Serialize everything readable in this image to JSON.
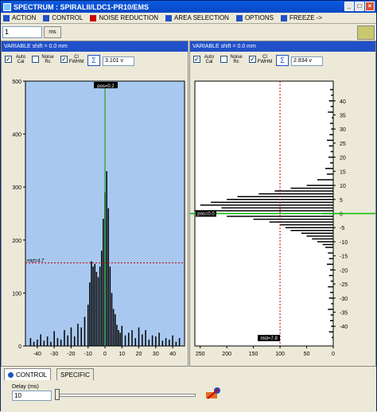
{
  "window": {
    "title": "SPECTRUM : SPIRALII/LDC1-PR10/EMS"
  },
  "menu": [
    {
      "label": "ACTION",
      "icon": "action-icon",
      "color": "#2050c8"
    },
    {
      "label": "CONTROL",
      "icon": "control-icon",
      "color": "#2050c8"
    },
    {
      "label": "NOISE REDUCTION",
      "icon": "noise-reduction-icon",
      "color": "#c80000"
    },
    {
      "label": "AREA SELECTION",
      "icon": "area-selection-icon",
      "color": "#2050c8"
    },
    {
      "label": "OPTIONS",
      "icon": "options-icon",
      "color": "#2050c8"
    },
    {
      "label": "FREEZE ->",
      "icon": "freeze-icon",
      "color": "#2050c8"
    }
  ],
  "toolbar": {
    "value": "1",
    "unit": "ms"
  },
  "left_panel": {
    "header": "VARIABLE shift = 0.0 mm",
    "auto_cal": {
      "label": "Auto Cal",
      "checked": true
    },
    "noise_rc": {
      "label": "Noise Rc",
      "checked": false
    },
    "cl_fwhm": {
      "label": "Cl FWHM",
      "checked": true
    },
    "sigma_value": "3.101 v",
    "marker_top": "pos=0.2",
    "marker_mid": "mid=4.7"
  },
  "right_panel": {
    "header": "VARIABLE shift = 0.0 mm",
    "auto_cal": {
      "label": "Auto Cal",
      "checked": true
    },
    "noise_rc": {
      "label": "Noise Rc",
      "checked": false
    },
    "cl_fwhm": {
      "label": "Cl FWHM",
      "checked": true
    },
    "sigma_value": "2.834 v",
    "marker_left": "pos=0.0",
    "marker_bottom": "mid=7.8"
  },
  "tabs": {
    "control": "CONTROL",
    "specific": "SPECIFIC"
  },
  "delay": {
    "label": "Delay (ms)",
    "value": "10"
  },
  "chart_data": [
    {
      "type": "bar",
      "x": [
        -44,
        -42,
        -40,
        -38,
        -36,
        -34,
        -32,
        -30,
        -28,
        -26,
        -24,
        -22,
        -20,
        -18,
        -16,
        -14,
        -12,
        -10,
        -9,
        -8,
        -7,
        -6,
        -5,
        -4,
        -3,
        -2,
        -1,
        0,
        1,
        2,
        3,
        4,
        5,
        6,
        7,
        8,
        9,
        10,
        12,
        14,
        16,
        18,
        20,
        22,
        24,
        26,
        28,
        30,
        32,
        34,
        36,
        38,
        40,
        42,
        44
      ],
      "values": [
        15,
        8,
        12,
        22,
        10,
        18,
        8,
        28,
        15,
        12,
        30,
        20,
        35,
        18,
        42,
        35,
        55,
        78,
        120,
        160,
        150,
        155,
        140,
        130,
        150,
        180,
        240,
        290,
        330,
        260,
        150,
        100,
        70,
        60,
        40,
        30,
        25,
        38,
        20,
        25,
        30,
        15,
        35,
        22,
        30,
        12,
        20,
        18,
        25,
        10,
        15,
        12,
        20,
        8,
        15
      ],
      "xlim": [
        -47,
        47
      ],
      "ylim": [
        0,
        500
      ],
      "xticks": [
        -40,
        -30,
        -20,
        -10,
        0,
        10,
        20,
        30,
        40
      ],
      "yticks": [
        0,
        100,
        200,
        300,
        400,
        500
      ],
      "series_color": "#000000",
      "background": "#a8c8f0"
    },
    {
      "type": "bar",
      "orientation": "horizontal",
      "y": [
        44,
        42,
        40,
        38,
        36,
        34,
        32,
        30,
        28,
        26,
        24,
        22,
        20,
        18,
        16,
        14,
        12,
        10,
        9,
        8,
        7,
        6,
        5,
        4,
        3,
        2,
        1,
        0,
        -1,
        -2,
        -3,
        -4,
        -5,
        -6,
        -7,
        -8,
        -9,
        -10,
        -11,
        -12,
        -14,
        -16,
        -18,
        -20,
        -22,
        -24,
        -26,
        -28,
        -30,
        -32,
        -34,
        -36,
        -38,
        -40,
        -42,
        -44
      ],
      "values": [
        6,
        4,
        8,
        5,
        10,
        3,
        6,
        4,
        7,
        12,
        8,
        5,
        9,
        6,
        15,
        12,
        30,
        50,
        80,
        110,
        140,
        180,
        200,
        230,
        250,
        210,
        260,
        20,
        200,
        150,
        120,
        100,
        90,
        80,
        60,
        50,
        40,
        30,
        20,
        15,
        10,
        8,
        12,
        6,
        8,
        5,
        10,
        6,
        8,
        4,
        10,
        5,
        6,
        4,
        8,
        3
      ],
      "ylim": [
        -47,
        47
      ],
      "xlim": [
        0,
        260
      ],
      "xticks": [
        250,
        200,
        150,
        100,
        50,
        0
      ],
      "yticks": [
        40,
        35,
        30,
        25,
        20,
        15,
        10,
        5,
        0,
        -5,
        -10,
        -15,
        -20,
        -25,
        -30,
        -35,
        -40
      ],
      "series_color": "#000000",
      "background": "#ffffff"
    }
  ]
}
